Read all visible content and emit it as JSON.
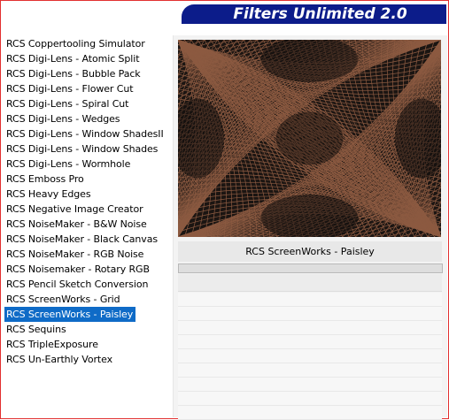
{
  "header": {
    "title": "Filters Unlimited 2.0"
  },
  "filters": [
    "RCS Coppertooling Simulator",
    "RCS Digi-Lens - Atomic Split",
    "RCS Digi-Lens - Bubble Pack",
    "RCS Digi-Lens - Flower Cut",
    "RCS Digi-Lens - Spiral Cut",
    "RCS Digi-Lens - Wedges",
    "RCS Digi-Lens - Window ShadesII",
    "RCS Digi-Lens - Window Shades",
    "RCS Digi-Lens - Wormhole",
    "RCS Emboss Pro",
    "RCS Heavy Edges",
    "RCS Negative Image Creator",
    "RCS NoiseMaker - B&W Noise",
    "RCS NoiseMaker - Black Canvas",
    "RCS NoiseMaker - RGB Noise",
    "RCS Noisemaker - Rotary RGB",
    "RCS Pencil Sketch Conversion",
    "RCS ScreenWorks - Grid",
    "RCS ScreenWorks - Paisley",
    "RCS Sequins",
    "RCS TripleExposure",
    "RCS Un-Earthly Vortex"
  ],
  "selected_filter": "RCS ScreenWorks - Paisley",
  "selected_index": 18,
  "preview": {
    "filter_name": "RCS ScreenWorks - Paisley"
  },
  "colors": {
    "header_bg": "#0c1c8a",
    "selection_bg": "#0f6bc7",
    "window_border": "#e23030",
    "preview_copper": "#a0674a",
    "preview_dark": "#1b1512"
  }
}
